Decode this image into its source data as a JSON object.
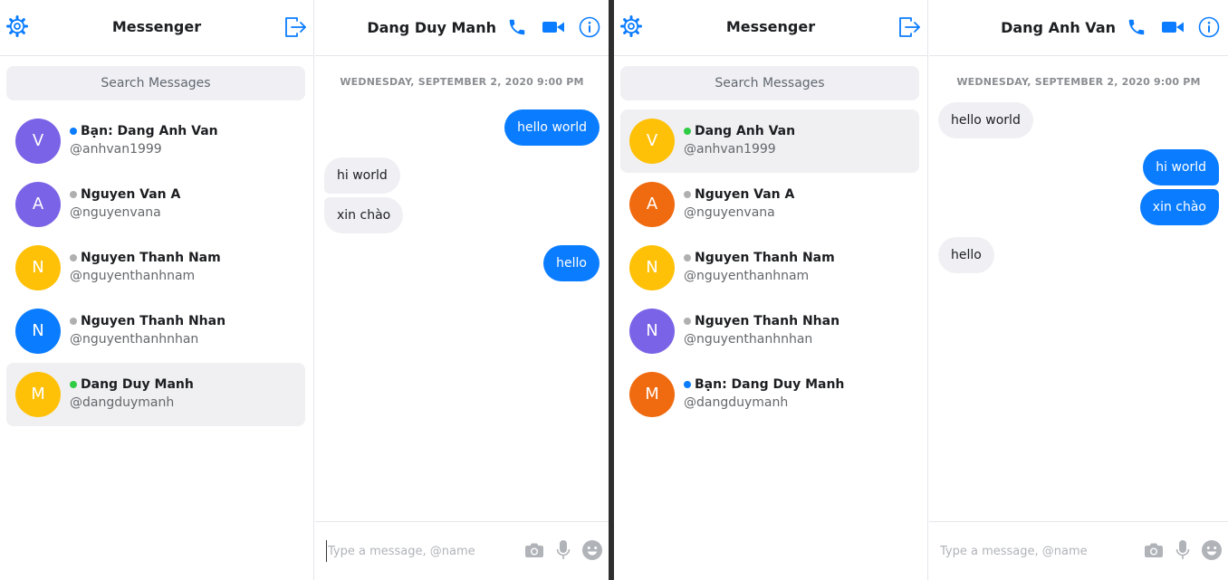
{
  "colors": {
    "accent": "#0a7cff",
    "online": "#31cc46",
    "offline": "#b0b0b0",
    "self": "#0a7cff",
    "avatar_purple": "#7a63e6",
    "avatar_yellow": "#ffc107",
    "avatar_blue": "#0a7cff",
    "avatar_orange": "#f06a0f"
  },
  "left": {
    "sidebar": {
      "title": "Messenger",
      "search_placeholder": "Search Messages",
      "contacts": [
        {
          "initial": "V",
          "name": "Bạn: Dang Anh Van",
          "handle": "@anhvan1999",
          "status": "self"
        },
        {
          "initial": "A",
          "name": "Nguyen Van A",
          "handle": "@nguyenvana",
          "status": "offline"
        },
        {
          "initial": "N",
          "name": "Nguyen Thanh Nam",
          "handle": "@nguyenthanhnam",
          "status": "offline"
        },
        {
          "initial": "N",
          "name": "Nguyen Thanh Nhan",
          "handle": "@nguyenthanhnhan",
          "status": "offline"
        },
        {
          "initial": "M",
          "name": "Dang Duy Manh",
          "handle": "@dangduymanh",
          "status": "online",
          "active": true
        }
      ]
    },
    "chat": {
      "title": "Dang Duy Manh",
      "timestamp": "WEDNESDAY, SEPTEMBER 2, 2020 9:00 PM",
      "messages": [
        {
          "text": "hello world",
          "direction": "out"
        },
        {
          "text": "hi world",
          "direction": "in"
        },
        {
          "text": "xin chào",
          "direction": "in"
        },
        {
          "text": "hello",
          "direction": "out"
        }
      ],
      "composer_placeholder": "Type a message, @name"
    }
  },
  "right": {
    "sidebar": {
      "title": "Messenger",
      "search_placeholder": "Search Messages",
      "contacts": [
        {
          "initial": "V",
          "name": "Dang Anh Van",
          "handle": "@anhvan1999",
          "status": "online",
          "active": true
        },
        {
          "initial": "A",
          "name": "Nguyen Van A",
          "handle": "@nguyenvana",
          "status": "offline"
        },
        {
          "initial": "N",
          "name": "Nguyen Thanh Nam",
          "handle": "@nguyenthanhnam",
          "status": "offline"
        },
        {
          "initial": "N",
          "name": "Nguyen Thanh Nhan",
          "handle": "@nguyenthanhnhan",
          "status": "offline"
        },
        {
          "initial": "M",
          "name": "Bạn: Dang Duy Manh",
          "handle": "@dangduymanh",
          "status": "self"
        }
      ]
    },
    "chat": {
      "title": "Dang Anh Van",
      "timestamp": "WEDNESDAY, SEPTEMBER 2, 2020 9:00 PM",
      "messages": [
        {
          "text": "hello world",
          "direction": "in"
        },
        {
          "text": "hi world",
          "direction": "out"
        },
        {
          "text": "xin chào",
          "direction": "out"
        },
        {
          "text": "hello",
          "direction": "in"
        }
      ],
      "composer_placeholder": "Type a message, @name"
    }
  },
  "icons": {
    "settings": "gear-icon",
    "logout": "logout-icon",
    "call": "phone-icon",
    "video": "video-camera-icon",
    "info": "info-icon",
    "camera": "camera-icon",
    "mic": "microphone-icon",
    "emoji": "emoji-icon"
  }
}
